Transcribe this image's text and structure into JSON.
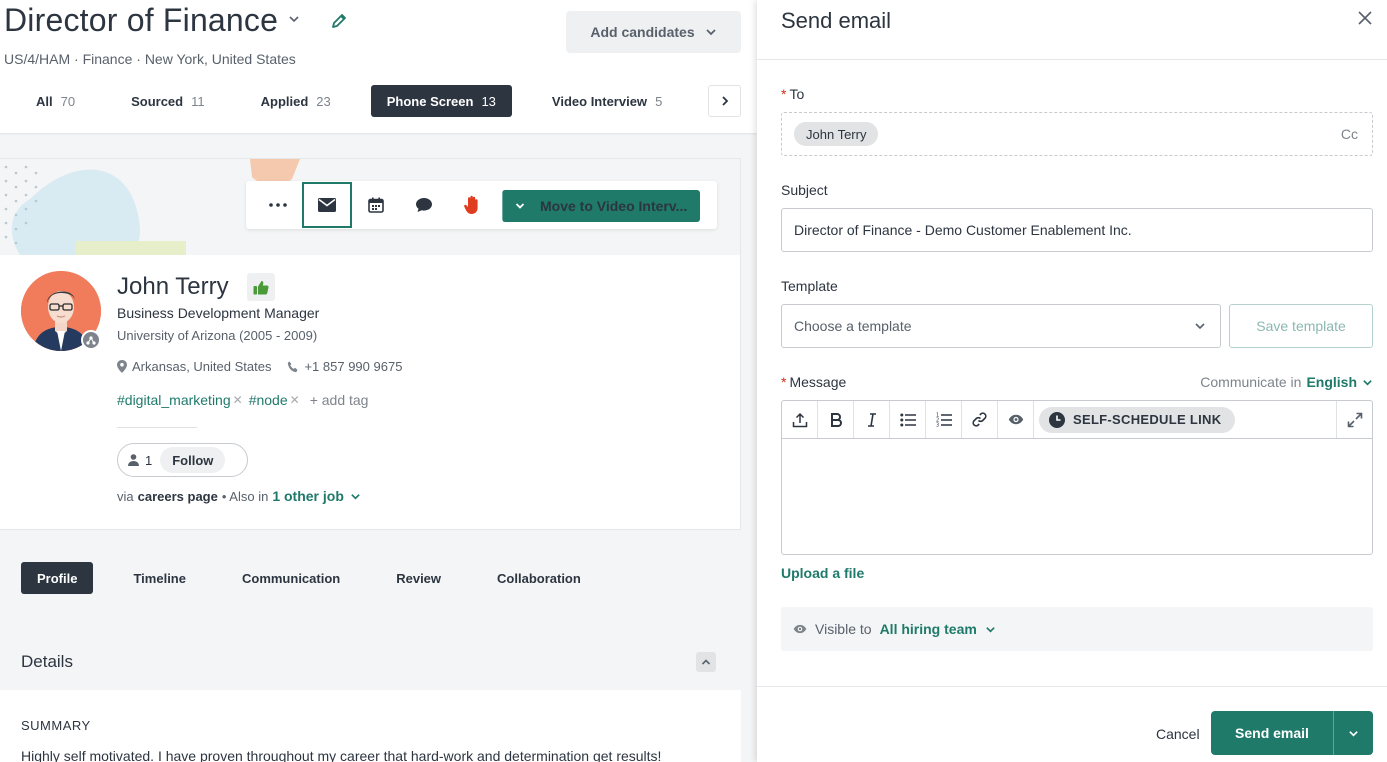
{
  "job": {
    "title": "Director of Finance",
    "subtitle": "US/4/HAM · Finance · New York, United States",
    "add_candidates_label": "Add candidates"
  },
  "stages": [
    {
      "label": "All",
      "count": "70",
      "active": false
    },
    {
      "label": "Sourced",
      "count": "11",
      "active": false
    },
    {
      "label": "Applied",
      "count": "23",
      "active": false
    },
    {
      "label": "Phone Screen",
      "count": "13",
      "active": true
    },
    {
      "label": "Video Interview",
      "count": "5",
      "active": false
    }
  ],
  "candidate": {
    "move_label": "Move to Video Interv...",
    "name": "John Terry",
    "role": "Business Development Manager",
    "education": "University of Arizona (2005 - 2009)",
    "location": "Arkansas, United States",
    "phone": "+1 857 990 9675",
    "tags": [
      "#digital_marketing",
      "#node"
    ],
    "add_tag_label": "+  add tag",
    "followers": "1",
    "follow_label": "Follow",
    "via_prefix": "via",
    "via_source": "careers page",
    "also_in_prefix": "• Also in",
    "also_in_link": "1 other job"
  },
  "profile_tabs": [
    {
      "label": "Profile",
      "active": true
    },
    {
      "label": "Timeline",
      "active": false
    },
    {
      "label": "Communication",
      "active": false
    },
    {
      "label": "Review",
      "active": false
    },
    {
      "label": "Collaboration",
      "active": false
    }
  ],
  "details": {
    "title": "Details",
    "summary_label": "SUMMARY",
    "summary_text": "Highly self motivated. I have proven throughout my career that hard-work and determination get results!"
  },
  "email": {
    "title": "Send email",
    "to_label": "To",
    "recipient": "John Terry",
    "cc_label": "Cc",
    "subject_label": "Subject",
    "subject_value": "Director of Finance - Demo Customer Enablement Inc.",
    "template_label": "Template",
    "template_placeholder": "Choose a template",
    "save_template_label": "Save template",
    "message_label": "Message",
    "communicate_prefix": "Communicate in",
    "language": "English",
    "self_schedule_label": "SELF-SCHEDULE LINK",
    "upload_label": "Upload a file",
    "visible_prefix": "Visible to",
    "visible_value": "All hiring team",
    "cancel_label": "Cancel",
    "send_label": "Send email"
  },
  "colors": {
    "accent": "#1f7a6a",
    "dark": "#2d3540",
    "required": "#d0321d"
  }
}
